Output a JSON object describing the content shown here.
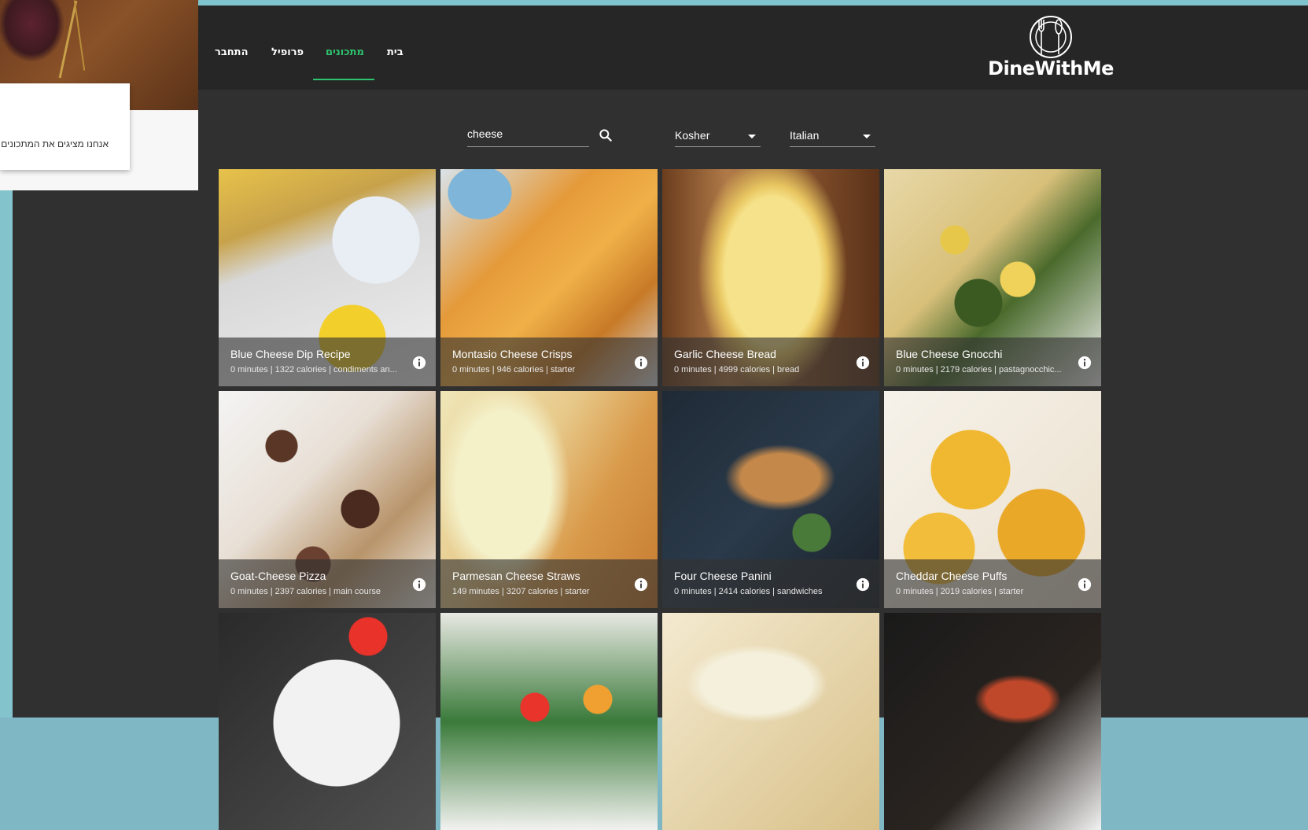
{
  "nav": {
    "brand": "DineWithMe",
    "items": [
      {
        "label": "בית",
        "active": false
      },
      {
        "label": "מתכונים",
        "active": true
      },
      {
        "label": "פרופיל",
        "active": false
      },
      {
        "label": "התחבר",
        "active": false
      }
    ]
  },
  "intro": {
    "text": "אנחנו מציגים את המתכונים"
  },
  "filters": {
    "search_value": "cheese",
    "diet": "Kosher",
    "cuisine": "Italian"
  },
  "colors": {
    "accent": "#2ec36e",
    "navbar": "#262626",
    "background": "#303030"
  },
  "recipes": [
    {
      "title": "Blue Cheese Dip Recipe",
      "meta": "0 minutes | 1322 calories | condiments an..."
    },
    {
      "title": "Montasio Cheese Crisps",
      "meta": "0 minutes | 946 calories | starter"
    },
    {
      "title": "Garlic Cheese Bread",
      "meta": "0 minutes | 4999 calories | bread"
    },
    {
      "title": "Blue Cheese Gnocchi",
      "meta": "0 minutes | 2179 calories | pastagnocchic..."
    },
    {
      "title": "Goat-Cheese Pizza",
      "meta": "0 minutes | 2397 calories | main course"
    },
    {
      "title": "Parmesan Cheese Straws",
      "meta": "149 minutes | 3207 calories | starter"
    },
    {
      "title": "Four Cheese Panini",
      "meta": "0 minutes | 2414 calories | sandwiches"
    },
    {
      "title": "Cheddar Cheese Puffs",
      "meta": "0 minutes | 2019 calories | starter"
    },
    {
      "title": "",
      "meta": ""
    },
    {
      "title": "",
      "meta": ""
    },
    {
      "title": "",
      "meta": ""
    },
    {
      "title": "",
      "meta": ""
    }
  ]
}
